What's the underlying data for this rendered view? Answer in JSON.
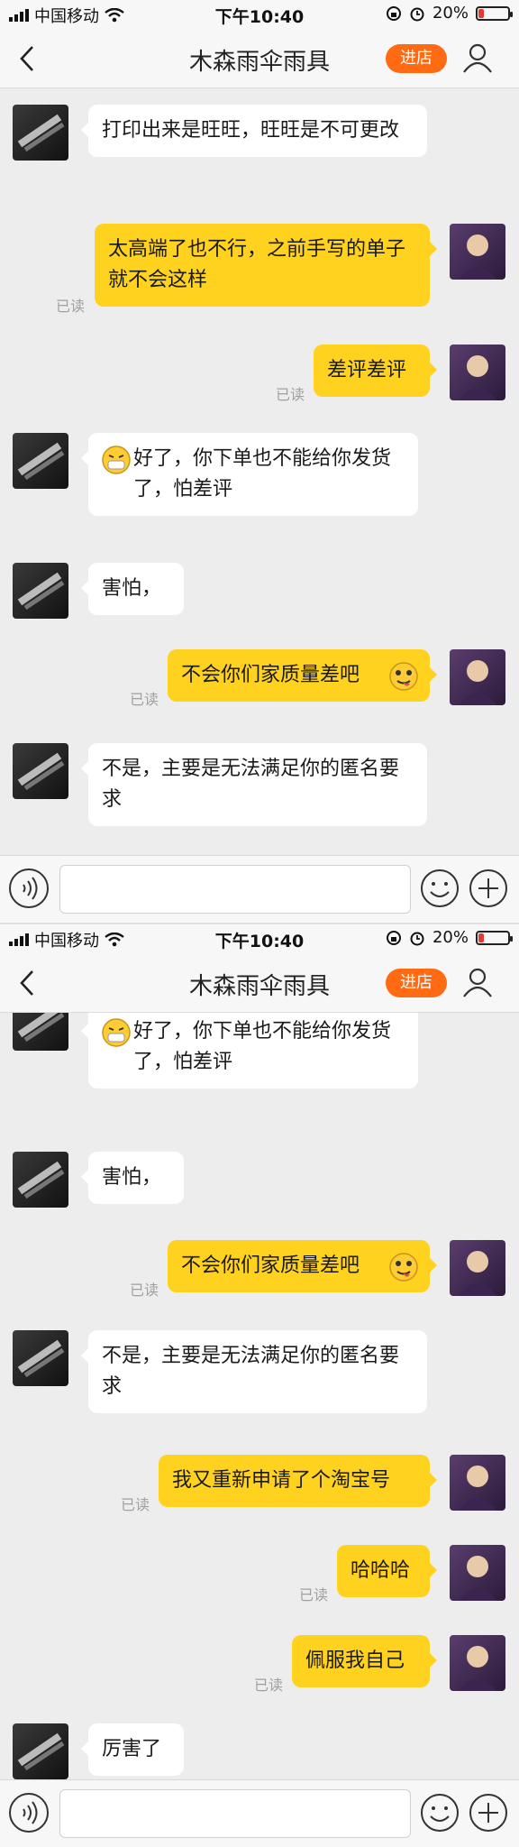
{
  "status": {
    "carrier": "中国移动",
    "time": "下午10:40",
    "battery": "20%"
  },
  "header": {
    "title": "木森雨伞雨具",
    "store_label": "进店"
  },
  "read_label": "已读",
  "screen1": {
    "messages": [
      {
        "side": "left",
        "text": "打印出来是旺旺，旺旺是不可更改"
      },
      {
        "side": "right",
        "text": "太高端了也不行，之前手写的单子就不会这样"
      },
      {
        "side": "right",
        "text": "差评差评"
      },
      {
        "side": "left",
        "text": "好了，你下单也不能给你发货了，怕差评"
      },
      {
        "side": "left",
        "text": "害怕，"
      },
      {
        "side": "right",
        "text": "不会你们家质量差吧"
      },
      {
        "side": "left",
        "text": "不是，主要是无法满足你的匿名要求"
      }
    ]
  },
  "screen2": {
    "messages": [
      {
        "side": "left",
        "text": "好了，你下单也不能给你发货了，怕差评"
      },
      {
        "side": "left",
        "text": "害怕，"
      },
      {
        "side": "right",
        "text": "不会你们家质量差吧"
      },
      {
        "side": "left",
        "text": "不是，主要是无法满足你的匿名要求"
      },
      {
        "side": "right",
        "text": "我又重新申请了个淘宝号"
      },
      {
        "side": "right",
        "text": "哈哈哈"
      },
      {
        "side": "right",
        "text": "佩服我自己"
      },
      {
        "side": "left",
        "text": "厉害了"
      }
    ]
  },
  "icons": {
    "back": "chevron-left-icon",
    "user": "user-icon",
    "voice": "voice-icon",
    "emoji": "smiley-icon",
    "add": "plus-icon",
    "sweat_emoji": "sweat-emoji-icon",
    "tongue_emoji": "tongue-emoji-icon"
  },
  "colors": {
    "accent": "#ff6a13",
    "bubble_mine": "#ffd21f",
    "bubble_theirs": "#ffffff",
    "background": "#ededed"
  }
}
